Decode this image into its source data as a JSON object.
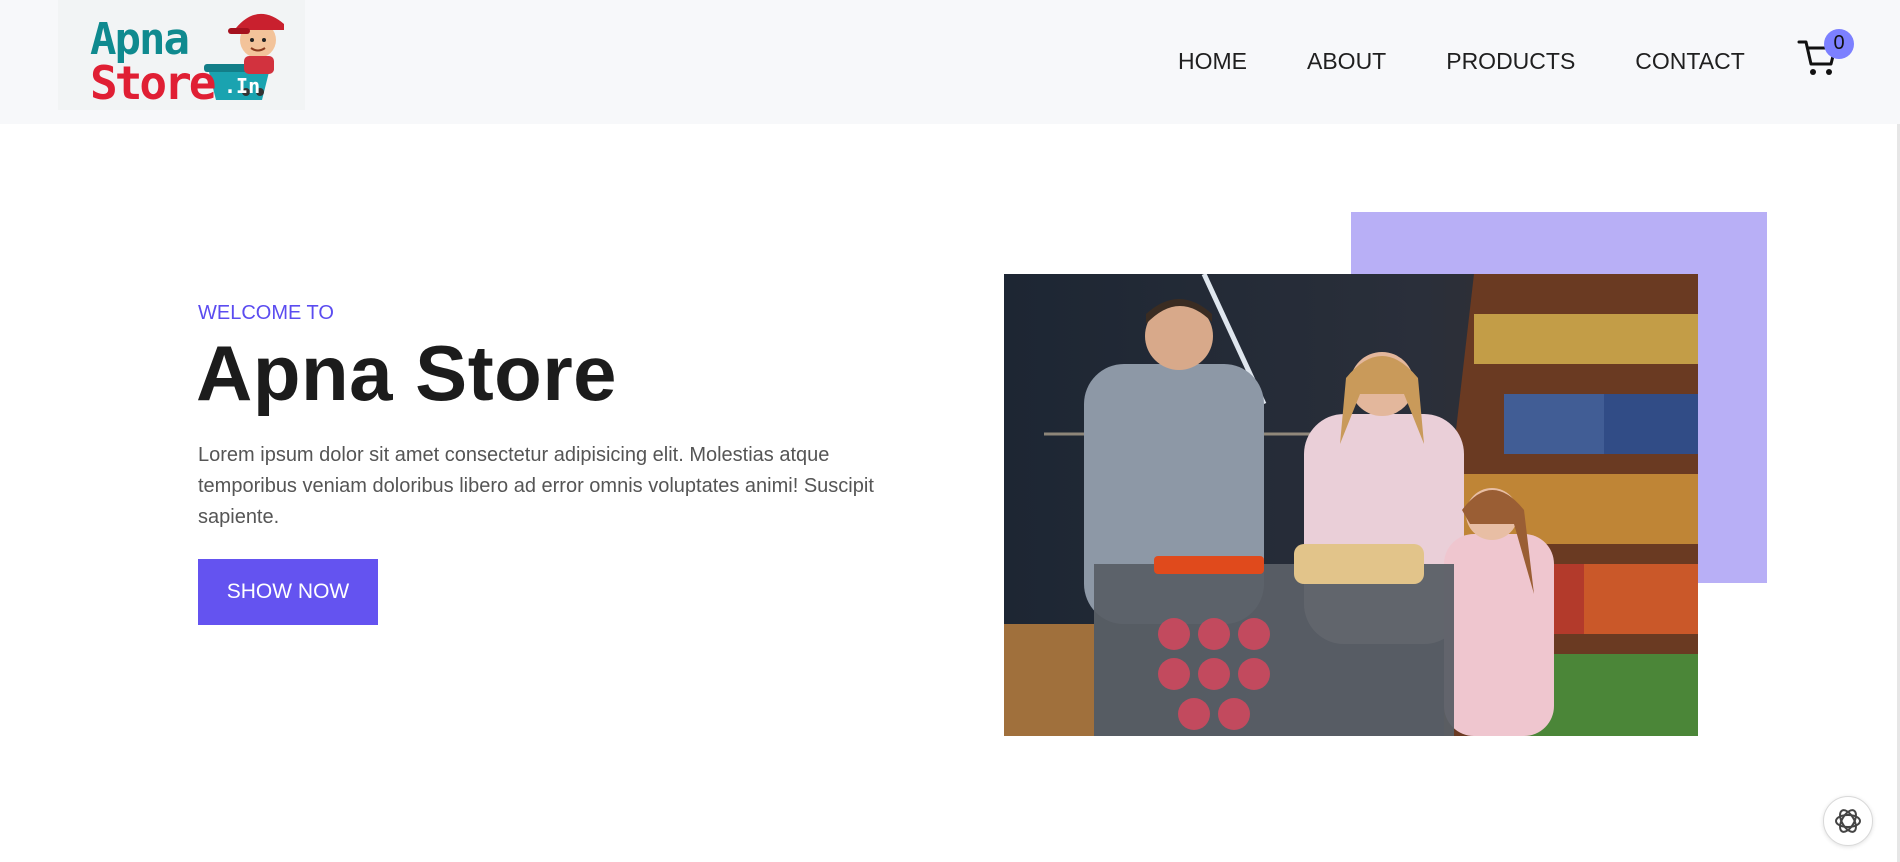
{
  "header": {
    "logo": {
      "line1": "Apna",
      "line2": "Store",
      "suffix": ".In"
    },
    "nav": [
      {
        "label": "HOME"
      },
      {
        "label": "ABOUT"
      },
      {
        "label": "PRODUCTS"
      },
      {
        "label": "CONTACT"
      }
    ],
    "cart": {
      "icon": "cart-icon",
      "count": "0"
    }
  },
  "hero": {
    "eyebrow": "WELCOME TO",
    "title": "Apna Store",
    "description": "Lorem ipsum dolor sit amet consectetur adipisicing elit. Molestias atque temporibus veniam doloribus libero ad error omnis voluptates animi! Suscipit sapiente.",
    "button_label": "SHOW NOW"
  },
  "colors": {
    "accent": "#6453f0",
    "eyebrow": "#5b4cf0",
    "accent_box": "#b8aff6",
    "badge": "#7c80ff",
    "header_bg": "#f7f8fa"
  },
  "icons": {
    "assistant": "openai-logo-icon"
  }
}
